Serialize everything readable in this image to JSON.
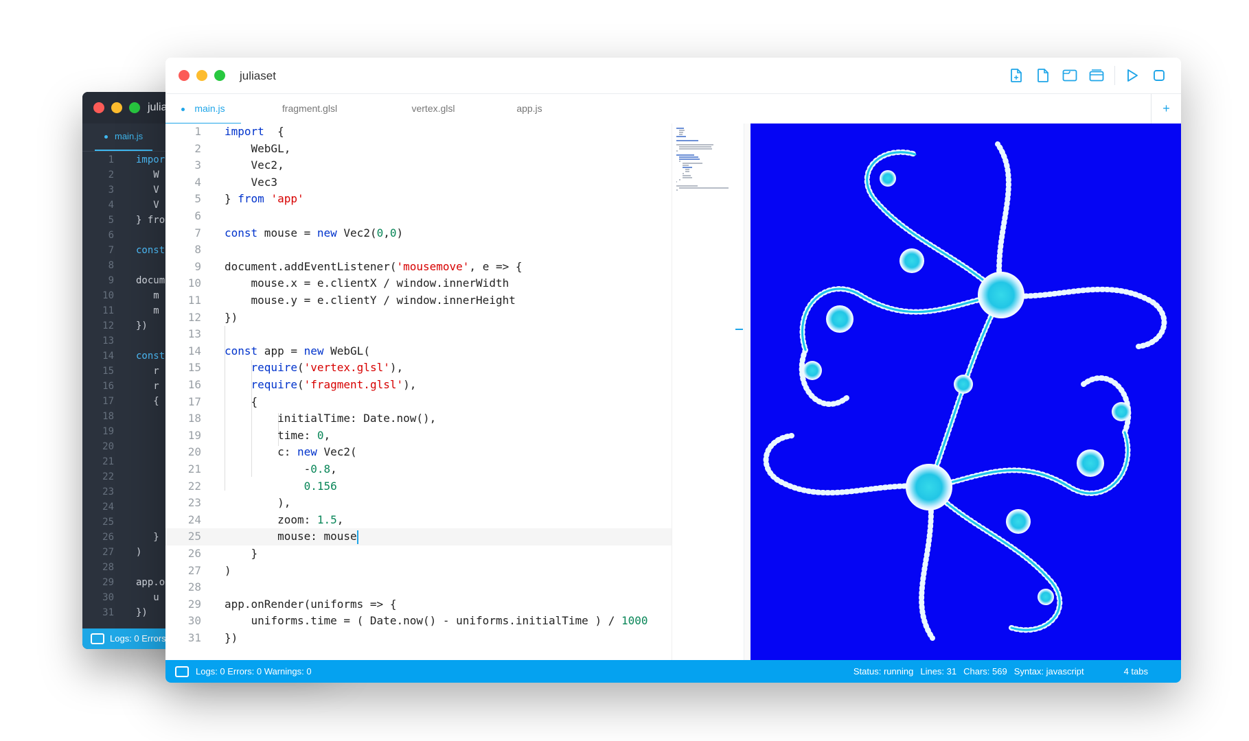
{
  "back_window": {
    "title": "julia",
    "active_tab": "main.js",
    "lines": [
      {
        "n": "1",
        "t": "impor",
        "kw": true
      },
      {
        "n": "2",
        "t": "   W"
      },
      {
        "n": "3",
        "t": "   V"
      },
      {
        "n": "4",
        "t": "   V"
      },
      {
        "n": "5",
        "t": "} fro"
      },
      {
        "n": "6",
        "t": ""
      },
      {
        "n": "7",
        "t": "const",
        "kw": true
      },
      {
        "n": "8",
        "t": ""
      },
      {
        "n": "9",
        "t": "docum"
      },
      {
        "n": "10",
        "t": "   m"
      },
      {
        "n": "11",
        "t": "   m"
      },
      {
        "n": "12",
        "t": "})"
      },
      {
        "n": "13",
        "t": ""
      },
      {
        "n": "14",
        "t": "const",
        "kw": true
      },
      {
        "n": "15",
        "t": "   r"
      },
      {
        "n": "16",
        "t": "   r"
      },
      {
        "n": "17",
        "t": "   {"
      },
      {
        "n": "18",
        "t": ""
      },
      {
        "n": "19",
        "t": ""
      },
      {
        "n": "20",
        "t": ""
      },
      {
        "n": "21",
        "t": ""
      },
      {
        "n": "22",
        "t": ""
      },
      {
        "n": "23",
        "t": ""
      },
      {
        "n": "24",
        "t": ""
      },
      {
        "n": "25",
        "t": ""
      },
      {
        "n": "26",
        "t": "   }"
      },
      {
        "n": "27",
        "t": ")"
      },
      {
        "n": "28",
        "t": ""
      },
      {
        "n": "29",
        "t": "app.o"
      },
      {
        "n": "30",
        "t": "   u"
      },
      {
        "n": "31",
        "t": "})"
      }
    ],
    "status": "Logs: 0 Errors:"
  },
  "front_window": {
    "title": "juliaset",
    "tabs": [
      "main.js",
      "fragment.glsl",
      "vertex.glsl",
      "app.js"
    ],
    "add_tab_label": "+",
    "code_lines": [
      {
        "n": "1",
        "tokens": [
          [
            "kw",
            "import"
          ],
          [
            "",
            "  {"
          ]
        ]
      },
      {
        "n": "2",
        "tokens": [
          [
            "",
            "    WebGL,"
          ]
        ]
      },
      {
        "n": "3",
        "tokens": [
          [
            "",
            "    Vec2,"
          ]
        ]
      },
      {
        "n": "4",
        "tokens": [
          [
            "",
            "    Vec3"
          ]
        ]
      },
      {
        "n": "5",
        "tokens": [
          [
            "",
            "} "
          ],
          [
            "kw",
            "from"
          ],
          [
            "",
            " "
          ],
          [
            "str",
            "'app'"
          ]
        ]
      },
      {
        "n": "6",
        "tokens": []
      },
      {
        "n": "7",
        "tokens": [
          [
            "kw",
            "const"
          ],
          [
            "",
            " mouse = "
          ],
          [
            "kw",
            "new"
          ],
          [
            "",
            " Vec2("
          ],
          [
            "num",
            "0"
          ],
          [
            "",
            ","
          ],
          [
            "num",
            "0"
          ],
          [
            "",
            ")"
          ]
        ]
      },
      {
        "n": "8",
        "tokens": []
      },
      {
        "n": "9",
        "tokens": [
          [
            "",
            "document.addEventListener("
          ],
          [
            "str",
            "'mousemove'"
          ],
          [
            "",
            ", e => {"
          ]
        ]
      },
      {
        "n": "10",
        "tokens": [
          [
            "",
            "    mouse.x = e.clientX / window.innerWidth"
          ]
        ]
      },
      {
        "n": "11",
        "tokens": [
          [
            "",
            "    mouse.y = e.clientY / window.innerHeight"
          ]
        ]
      },
      {
        "n": "12",
        "tokens": [
          [
            "",
            "})"
          ]
        ]
      },
      {
        "n": "13",
        "tokens": []
      },
      {
        "n": "14",
        "tokens": [
          [
            "kw",
            "const"
          ],
          [
            "",
            " app = "
          ],
          [
            "kw",
            "new"
          ],
          [
            "",
            " WebGL("
          ]
        ]
      },
      {
        "n": "15",
        "tokens": [
          [
            "",
            "    "
          ],
          [
            "kw",
            "require"
          ],
          [
            "",
            "("
          ],
          [
            "str",
            "'vertex.glsl'"
          ],
          [
            "",
            "),"
          ]
        ]
      },
      {
        "n": "16",
        "tokens": [
          [
            "",
            "    "
          ],
          [
            "kw",
            "require"
          ],
          [
            "",
            "("
          ],
          [
            "str",
            "'fragment.glsl'"
          ],
          [
            "",
            "),"
          ]
        ]
      },
      {
        "n": "17",
        "tokens": [
          [
            "",
            "    {"
          ]
        ]
      },
      {
        "n": "18",
        "tokens": [
          [
            "",
            "        initialTime: Date.now(),"
          ]
        ]
      },
      {
        "n": "19",
        "tokens": [
          [
            "",
            "        time: "
          ],
          [
            "num",
            "0"
          ],
          [
            "",
            ","
          ]
        ]
      },
      {
        "n": "20",
        "tokens": [
          [
            "",
            "        c: "
          ],
          [
            "kw",
            "new"
          ],
          [
            "",
            " Vec2("
          ]
        ]
      },
      {
        "n": "21",
        "tokens": [
          [
            "",
            "            -"
          ],
          [
            "num",
            "0.8"
          ],
          [
            "",
            ","
          ]
        ]
      },
      {
        "n": "22",
        "tokens": [
          [
            "",
            "            "
          ],
          [
            "num",
            "0.156"
          ]
        ]
      },
      {
        "n": "23",
        "tokens": [
          [
            "",
            "        ),"
          ]
        ]
      },
      {
        "n": "24",
        "tokens": [
          [
            "",
            "        zoom: "
          ],
          [
            "num",
            "1.5"
          ],
          [
            "",
            ","
          ]
        ]
      },
      {
        "n": "25",
        "tokens": [
          [
            "",
            "        mouse: mouse"
          ]
        ]
      },
      {
        "n": "26",
        "tokens": [
          [
            "",
            "    }"
          ]
        ]
      },
      {
        "n": "27",
        "tokens": [
          [
            "",
            ")"
          ]
        ]
      },
      {
        "n": "28",
        "tokens": []
      },
      {
        "n": "29",
        "tokens": [
          [
            "",
            "app.onRender(uniforms => {"
          ]
        ]
      },
      {
        "n": "30",
        "tokens": [
          [
            "",
            "    uniforms.time = ( Date.now() - uniforms.initialTime ) / "
          ],
          [
            "num",
            "1000"
          ]
        ]
      },
      {
        "n": "31",
        "tokens": [
          [
            "",
            "})"
          ]
        ]
      }
    ],
    "current_line": "25",
    "status": {
      "logs": "Logs: 0 Errors: 0 Warnings: 0",
      "state": "Status: running",
      "lines": "Lines: 31",
      "chars": "Chars: 569",
      "syntax": "Syntax: javascript",
      "tabs": "4 tabs"
    },
    "toolbar_icons": [
      "new-file-icon",
      "file-icon",
      "folder-icon",
      "folders-icon",
      "play-icon",
      "stop-icon"
    ]
  },
  "colors": {
    "accent": "#1fa5e8",
    "status_bar": "#05a2f0",
    "preview_bg": "#0505f4",
    "keyword": "#0033cc",
    "string": "#d70000",
    "number": "#098658"
  }
}
